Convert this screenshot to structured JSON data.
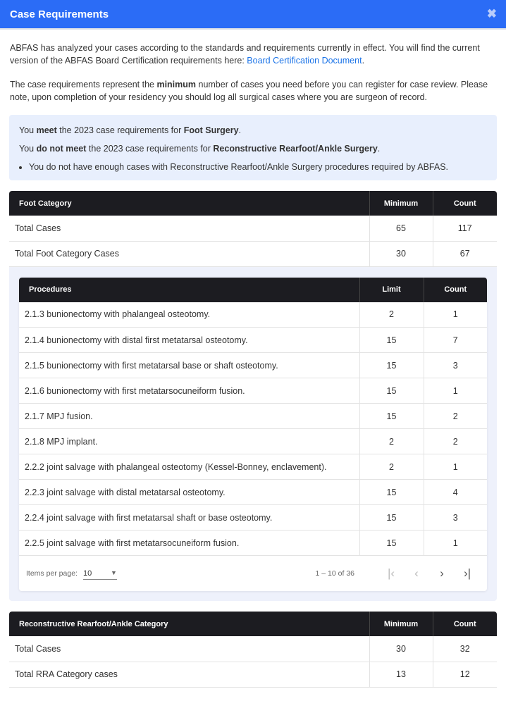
{
  "header": {
    "title": "Case Requirements",
    "close_icon": "close-icon"
  },
  "intro": {
    "p1": "ABFAS has analyzed your cases according to the standards and requirements currently in effect. You will find the current version of the ABFAS Board Certification requirements here: ",
    "link": "Board Certification Document",
    "p1_end": ".",
    "p2a": "The case requirements represent the ",
    "p2b": "minimum",
    "p2c": " number of cases you need before you can register for case review. Please note, upon completion of your residency you should log all surgical cases where you are surgeon of record."
  },
  "status": {
    "l1a": "You ",
    "l1b": "meet",
    "l1c": " the 2023 case requirements for ",
    "l1d": "Foot Surgery",
    "l1e": ".",
    "l2a": "You ",
    "l2b": "do not meet",
    "l2c": " the 2023 case requirements for ",
    "l2d": "Reconstructive Rearfoot/Ankle Surgery",
    "l2e": ".",
    "bullet": "You do not have enough cases with Reconstructive Rearfoot/Ankle Surgery procedures required by ABFAS."
  },
  "foot": {
    "headers": [
      "Foot Category",
      "Minimum",
      "Count"
    ],
    "rows": [
      [
        "Total Cases",
        "65",
        "117"
      ],
      [
        "Total Foot Category Cases",
        "30",
        "67"
      ]
    ]
  },
  "procedures": {
    "headers": [
      "Procedures",
      "Limit",
      "Count"
    ],
    "rows": [
      [
        "2.1.3 bunionectomy with phalangeal osteotomy.",
        "2",
        "1"
      ],
      [
        "2.1.4 bunionectomy with distal first metatarsal osteotomy.",
        "15",
        "7"
      ],
      [
        "2.1.5 bunionectomy with first metatarsal base or shaft osteotomy.",
        "15",
        "3"
      ],
      [
        "2.1.6 bunionectomy with first metatarsocuneiform fusion.",
        "15",
        "1"
      ],
      [
        "2.1.7 MPJ fusion.",
        "15",
        "2"
      ],
      [
        "2.1.8 MPJ implant.",
        "2",
        "2"
      ],
      [
        "2.2.2 joint salvage with phalangeal osteotomy (Kessel-Bonney, enclavement).",
        "2",
        "1"
      ],
      [
        "2.2.3 joint salvage with distal metatarsal osteotomy.",
        "15",
        "4"
      ],
      [
        "2.2.4 joint salvage with first metatarsal shaft or base osteotomy.",
        "15",
        "3"
      ],
      [
        "2.2.5 joint salvage with first metatarsocuneiform fusion.",
        "15",
        "1"
      ]
    ],
    "paginator": {
      "label": "Items per page:",
      "value": "10",
      "range": "1 – 10 of 36"
    }
  },
  "rra": {
    "headers": [
      "Reconstructive Rearfoot/Ankle Category",
      "Minimum",
      "Count"
    ],
    "rows": [
      [
        "Total Cases",
        "30",
        "32"
      ],
      [
        "Total RRA Category cases",
        "13",
        "12"
      ]
    ]
  }
}
